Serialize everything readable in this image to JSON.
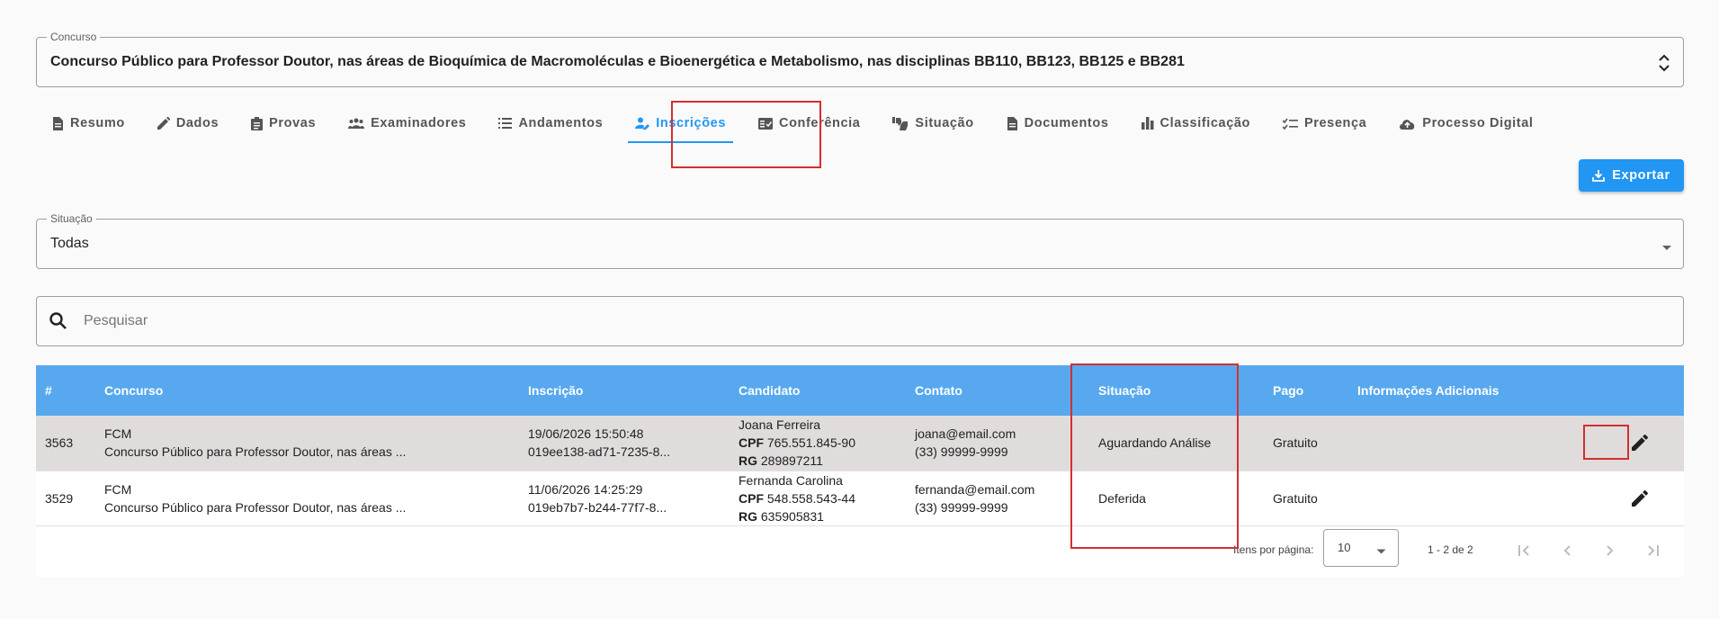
{
  "contest": {
    "label": "Concurso",
    "value": "Concurso Público para Professor Doutor, nas áreas de Bioquímica de Macromoléculas e Bioenergética e Metabolismo, nas disciplinas BB110, BB123, BB125 e BB281"
  },
  "tabs": [
    {
      "label": "Resumo",
      "icon": "document-icon"
    },
    {
      "label": "Dados",
      "icon": "pencil-icon"
    },
    {
      "label": "Provas",
      "icon": "clipboard-icon"
    },
    {
      "label": "Examinadores",
      "icon": "people-icon"
    },
    {
      "label": "Andamentos",
      "icon": "list-icon"
    },
    {
      "label": "Inscrições",
      "icon": "person-edit-icon",
      "active": true
    },
    {
      "label": "Conferência",
      "icon": "fact-check-icon"
    },
    {
      "label": "Situação",
      "icon": "thumbs-icon"
    },
    {
      "label": "Documentos",
      "icon": "document-icon"
    },
    {
      "label": "Classificação",
      "icon": "bar-chart-icon"
    },
    {
      "label": "Presença",
      "icon": "checklist-icon"
    },
    {
      "label": "Processo Digital",
      "icon": "cloud-upload-icon"
    }
  ],
  "export": {
    "label": "Exportar"
  },
  "status_filter": {
    "label": "Situação",
    "value": "Todas"
  },
  "search": {
    "placeholder": "Pesquisar"
  },
  "table": {
    "columns": [
      "#",
      "Concurso",
      "Inscrição",
      "Candidato",
      "Contato",
      "Situação",
      "Pago",
      "Informações Adicionais"
    ],
    "rows": [
      {
        "id": "3563",
        "contest_code": "FCM",
        "contest_name": "Concurso Público para Professor Doutor, nas áreas ...",
        "inscription_date": "19/06/2026 15:50:48",
        "inscription_id": "019ee138-ad71-7235-8...",
        "candidate_name": "Joana Ferreira",
        "cpf_label": "CPF",
        "cpf": "765.551.845-90",
        "rg_label": "RG",
        "rg": "289897211",
        "email": "joana@email.com",
        "phone": "(33) 99999-9999",
        "status": "Aguardando Análise",
        "paid": "Gratuito",
        "extra": ""
      },
      {
        "id": "3529",
        "contest_code": "FCM",
        "contest_name": "Concurso Público para Professor Doutor, nas áreas ...",
        "inscription_date": "11/06/2026 14:25:29",
        "inscription_id": "019eb7b7-b244-77f7-8...",
        "candidate_name": "Fernanda Carolina",
        "cpf_label": "CPF",
        "cpf": "548.558.543-44",
        "rg_label": "RG",
        "rg": "635905831",
        "email": "fernanda@email.com",
        "phone": "(33) 99999-9999",
        "status": "Deferida",
        "paid": "Gratuito",
        "extra": ""
      }
    ]
  },
  "paginator": {
    "items_per_page_label": "Itens por página:",
    "items_per_page": "10",
    "range": "1 - 2 de 2"
  },
  "colors": {
    "accent": "#2196f3",
    "header_bg": "#57a8ef",
    "highlight_row": "#e0dcdc",
    "annotation": "#d32f2f"
  }
}
